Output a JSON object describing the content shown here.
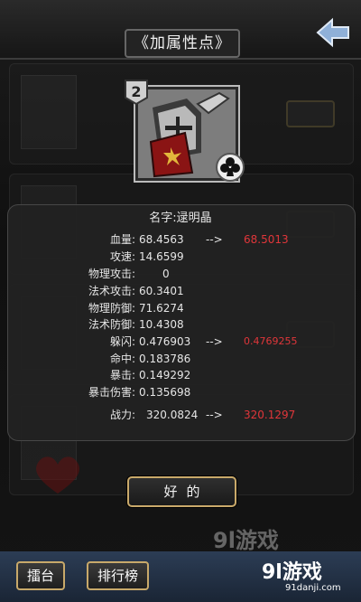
{
  "header": {
    "title": "《加属性点》"
  },
  "card": {
    "level": "2"
  },
  "panel": {
    "name": "名字:逯明晶",
    "stats": [
      {
        "label": "血量:",
        "value": "68.4563",
        "arrow": "-->",
        "new": "68.5013"
      },
      {
        "label": "攻速:",
        "value": "14.6599",
        "arrow": "",
        "new": ""
      },
      {
        "label": "物理攻击:",
        "value": "0",
        "arrow": "",
        "new": ""
      },
      {
        "label": "法术攻击:",
        "value": "60.3401",
        "arrow": "",
        "new": ""
      },
      {
        "label": "物理防御:",
        "value": "71.6274",
        "arrow": "",
        "new": ""
      },
      {
        "label": "法术防御:",
        "value": "10.4308",
        "arrow": "",
        "new": ""
      },
      {
        "label": "躲闪:",
        "value": "0.476903",
        "arrow": "-->",
        "new": "0.4769255"
      },
      {
        "label": "命中:",
        "value": "0.183786",
        "arrow": "",
        "new": ""
      },
      {
        "label": "暴击:",
        "value": "0.149292",
        "arrow": "",
        "new": ""
      },
      {
        "label": "暴击伤害:",
        "value": "0.135698",
        "arrow": "",
        "new": ""
      }
    ],
    "power": {
      "label": "战力:",
      "value": "320.0824",
      "arrow": "-->",
      "new": "320.1297"
    },
    "ok_label": "好的"
  },
  "bottom_bar": {
    "arena": "擂台",
    "ranking": "排行榜"
  },
  "watermark": {
    "brand": "9l游戏",
    "site": "91danji.com"
  },
  "colors": {
    "increase": "#e0363a",
    "button_border": "#c9a96a",
    "panel_bg": "#222222"
  },
  "icons": {
    "back": "back-arrow-icon",
    "suit": "club-icon",
    "level": "level-badge-icon"
  }
}
